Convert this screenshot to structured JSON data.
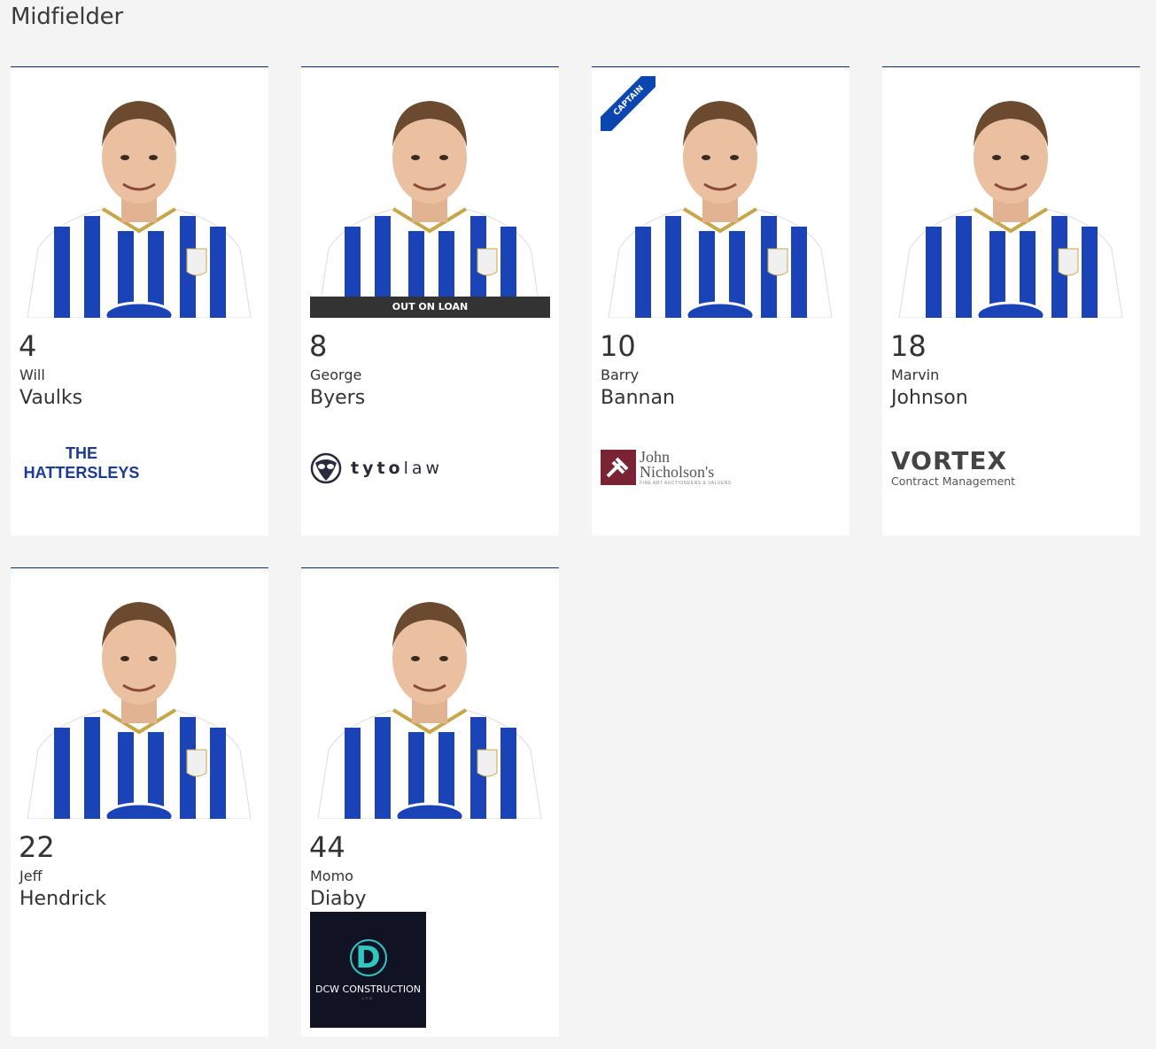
{
  "section": {
    "title": "Midfielder"
  },
  "colors": {
    "card_border": "#0b2a6e",
    "shirt_blue": "#1b43b8",
    "captain_blue": "#0b46b0"
  },
  "players": [
    {
      "number": "4",
      "first_name": "Will",
      "last_name": "Vaulks",
      "sponsor": {
        "line1": "THE",
        "line2": "HATTERSLEYS"
      }
    },
    {
      "number": "8",
      "first_name": "George",
      "last_name": "Byers",
      "status": "OUT ON LOAN",
      "sponsor": {
        "part1": "tyto",
        "part2": "law"
      }
    },
    {
      "number": "10",
      "first_name": "Barry",
      "last_name": "Bannan",
      "badge": "CAPTAIN",
      "sponsor": {
        "line1": "John",
        "line2": "Nicholson's",
        "tagline": "FINE ART AUCTIONEERS & VALUERS"
      }
    },
    {
      "number": "18",
      "first_name": "Marvin",
      "last_name": "Johnson",
      "sponsor": {
        "line1": "VORTEX",
        "line2": "Contract Management"
      }
    },
    {
      "number": "22",
      "first_name": "Jeff",
      "last_name": "Hendrick"
    },
    {
      "number": "44",
      "first_name": "Momo",
      "last_name": "Diaby",
      "sponsor": {
        "letter": "D",
        "line1": "DCW CONSTRUCTION",
        "line2": "LTD"
      }
    }
  ]
}
